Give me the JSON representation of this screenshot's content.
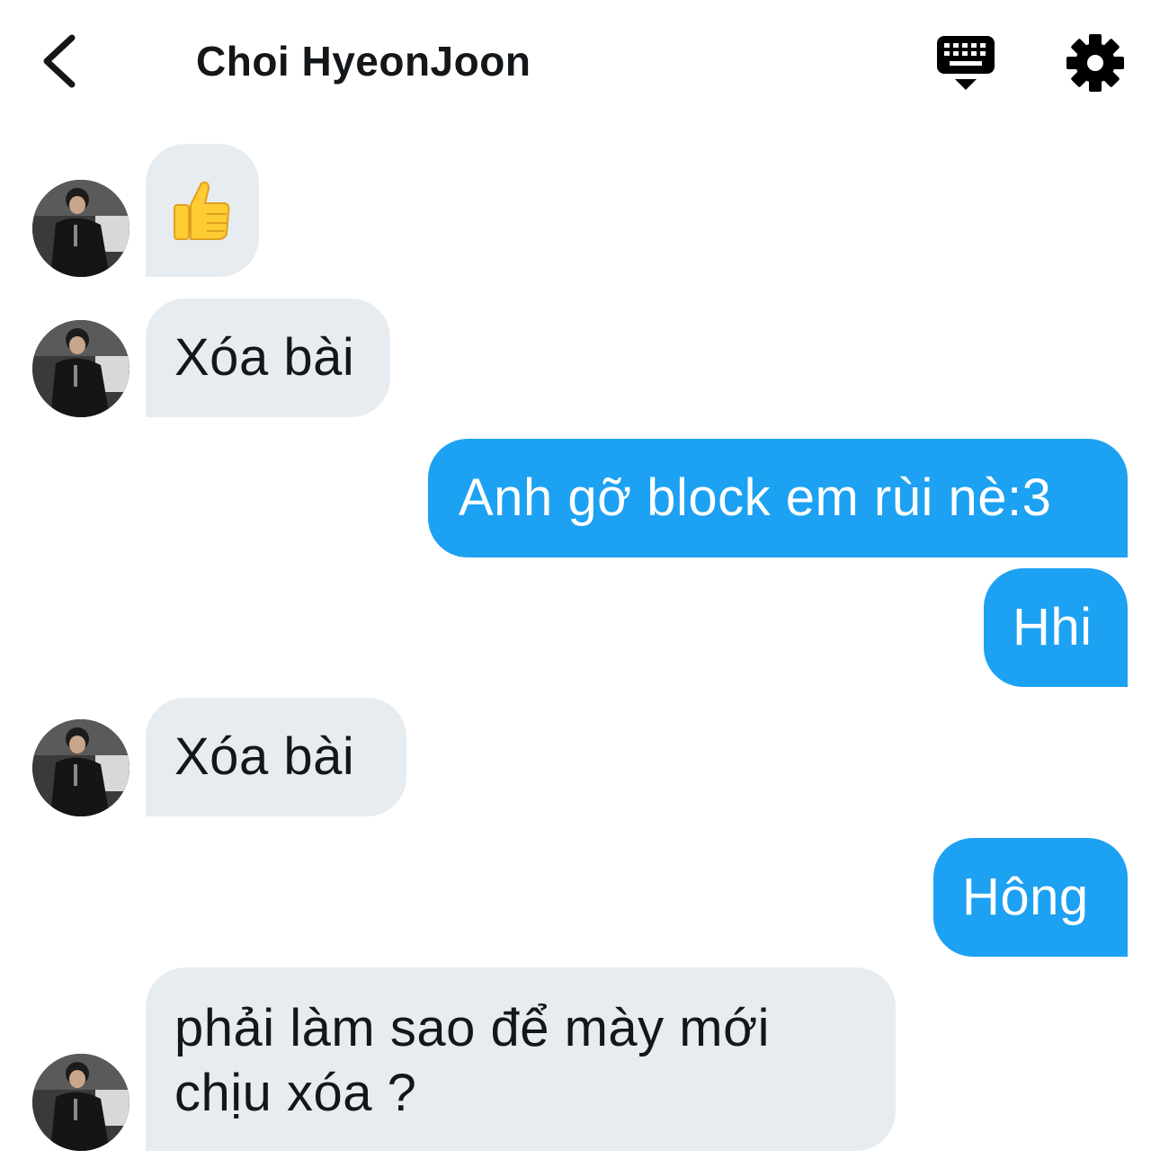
{
  "header": {
    "title": "Choi HyeonJoon",
    "back_icon": "chevron-left-icon",
    "keyboard_icon": "keyboard-icon",
    "settings_icon": "gear-icon"
  },
  "messages": [
    {
      "direction": "incoming",
      "type": "emoji",
      "emoji": "thumbs-up-icon",
      "text": ""
    },
    {
      "direction": "incoming",
      "type": "text",
      "text": "Xóa bài"
    },
    {
      "direction": "outgoing",
      "type": "text",
      "text": "Anh gỡ block em rùi nè:3"
    },
    {
      "direction": "outgoing",
      "type": "text",
      "text": "Hhi"
    },
    {
      "direction": "incoming",
      "type": "text",
      "text": "Xóa bài"
    },
    {
      "direction": "outgoing",
      "type": "text",
      "text": "Hông"
    },
    {
      "direction": "incoming",
      "type": "text",
      "lines": [
        "phải làm sao để mày mới",
        "chịu xóa ?"
      ]
    }
  ],
  "colors": {
    "incoming_bubble": "#e6ecf0",
    "outgoing_bubble": "#1da1f2",
    "text": "#14171a"
  }
}
